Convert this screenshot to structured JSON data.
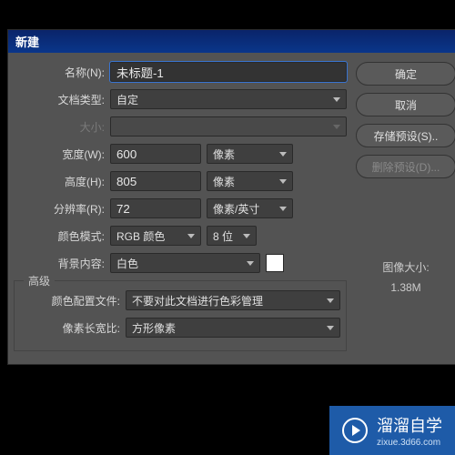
{
  "dialog": {
    "title": "新建",
    "name_label": "名称(N):",
    "name_value": "未标题-1",
    "doctype_label": "文档类型:",
    "doctype_value": "自定",
    "size_label": "大小:",
    "size_value": "",
    "width_label": "宽度(W):",
    "width_value": "600",
    "width_unit": "像素",
    "height_label": "高度(H):",
    "height_value": "805",
    "height_unit": "像素",
    "res_label": "分辨率(R):",
    "res_value": "72",
    "res_unit": "像素/英寸",
    "colormode_label": "颜色模式:",
    "colormode_value": "RGB 颜色",
    "colorbits_value": "8 位",
    "bg_label": "背景内容:",
    "bg_value": "白色",
    "advanced_legend": "高级",
    "profile_label": "颜色配置文件:",
    "profile_value": "不要对此文档进行色彩管理",
    "aspect_label": "像素长宽比:",
    "aspect_value": "方形像素"
  },
  "buttons": {
    "ok": "确定",
    "cancel": "取消",
    "save_preset": "存储预设(S)..",
    "delete_preset": "删除预设(D)..."
  },
  "info": {
    "size_label": "图像大小:",
    "size_value": "1.38M"
  },
  "watermark": {
    "brand": "溜溜自学",
    "url": "zixue.3d66.com"
  }
}
